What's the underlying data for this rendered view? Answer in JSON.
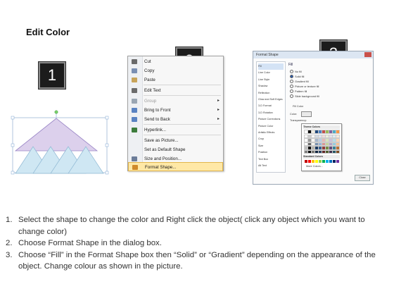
{
  "title": "Edit Color",
  "badges": [
    "1",
    "2",
    "3"
  ],
  "context_menu": {
    "items": [
      {
        "label": "Cut",
        "icon": "scissors-icon",
        "icon_color": "#6a6a6a",
        "disabled": false,
        "submenu": false,
        "highlight": false
      },
      {
        "label": "Copy",
        "icon": "copy-icon",
        "icon_color": "#7a8fb3",
        "disabled": false,
        "submenu": false,
        "highlight": false
      },
      {
        "label": "Paste",
        "icon": "paste-icon",
        "icon_color": "#c8a45a",
        "disabled": false,
        "submenu": false,
        "highlight": false
      },
      {
        "label": "Edit Text",
        "icon": "edit-text-icon",
        "icon_color": "#6b6b6b",
        "disabled": false,
        "submenu": false,
        "highlight": false
      },
      {
        "label": "Group",
        "icon": "group-icon",
        "icon_color": "#9aa6b3",
        "disabled": true,
        "submenu": true,
        "highlight": false
      },
      {
        "label": "Bring to Front",
        "icon": "bring-to-front-icon",
        "icon_color": "#5a83c2",
        "disabled": false,
        "submenu": true,
        "highlight": false
      },
      {
        "label": "Send to Back",
        "icon": "send-to-back-icon",
        "icon_color": "#5a83c2",
        "disabled": false,
        "submenu": true,
        "highlight": false
      },
      {
        "label": "Hyperlink...",
        "icon": "hyperlink-icon",
        "icon_color": "#3c7c3c",
        "disabled": false,
        "submenu": false,
        "highlight": false
      },
      {
        "label": "Save as Picture...",
        "icon": "",
        "icon_color": "",
        "disabled": false,
        "submenu": false,
        "highlight": false
      },
      {
        "label": "Set as Default Shape",
        "icon": "",
        "icon_color": "",
        "disabled": false,
        "submenu": false,
        "highlight": false
      },
      {
        "label": "Size and Position...",
        "icon": "size-position-icon",
        "icon_color": "#6b7c99",
        "disabled": false,
        "submenu": false,
        "highlight": false
      },
      {
        "label": "Format Shape...",
        "icon": "format-shape-icon",
        "icon_color": "#d08a2a",
        "disabled": false,
        "submenu": false,
        "highlight": true
      }
    ]
  },
  "format_dialog": {
    "title": "Format Shape",
    "nav": [
      "Fill",
      "Line Color",
      "Line Style",
      "Shadow",
      "Reflection",
      "Glow and Soft Edges",
      "3-D Format",
      "3-D Rotation",
      "Picture Corrections",
      "Picture Color",
      "Artistic Effects",
      "Crop",
      "Size",
      "Position",
      "Text Box",
      "Alt Text"
    ],
    "pane_title": "Fill",
    "options": [
      {
        "label": "No fill",
        "on": false
      },
      {
        "label": "Solid fill",
        "on": true
      },
      {
        "label": "Gradient fill",
        "on": false
      },
      {
        "label": "Picture or texture fill",
        "on": false
      },
      {
        "label": "Pattern fill",
        "on": false
      },
      {
        "label": "Slide background fill",
        "on": false
      }
    ],
    "fill_color_label": "Fill Color",
    "color_label": "Color:",
    "transparency_label": "Transparency:",
    "theme_colors_label": "Theme Colors",
    "standard_colors_label": "Standard Colors",
    "more_colors_label": "More Colors...",
    "close_label": "Close",
    "theme_top": [
      "#ffffff",
      "#000000",
      "#eeece1",
      "#1f497d",
      "#4f81bd",
      "#c0504d",
      "#9bbb59",
      "#8064a2",
      "#4bacc6",
      "#f79646"
    ],
    "standard": [
      "#c00000",
      "#ff0000",
      "#ffc000",
      "#ffff00",
      "#92d050",
      "#00b050",
      "#00b0f0",
      "#0070c0",
      "#002060",
      "#7030a0"
    ]
  },
  "steps": [
    {
      "num": "1.",
      "text": "Select the shape to change the color and Right click the object( click any object which you want to change color)"
    },
    {
      "num": "2.",
      "text": "Choose Format Shape in the dialog box."
    },
    {
      "num": "3.",
      "text": "Choose “Fill” in the Format Shape box then “Solid” or “Gradient” depending on the appearance of the object. Change colour as shown in the picture."
    }
  ]
}
